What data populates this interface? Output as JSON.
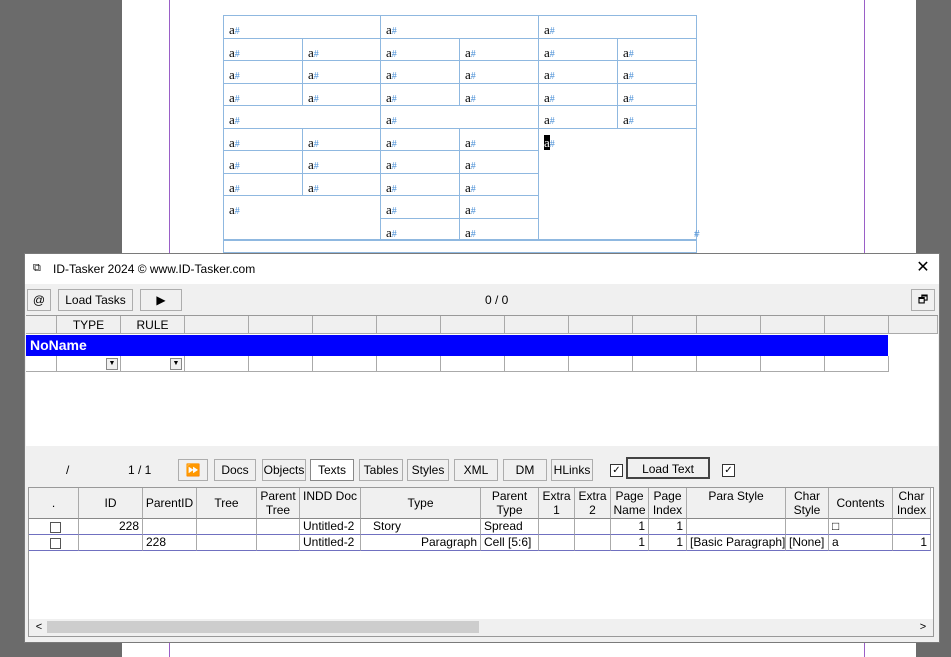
{
  "document": {
    "cell_glyph": "a",
    "hash_glyph": "#"
  },
  "window": {
    "title": "ID-Tasker 2024  © www.ID-Tasker.com",
    "close_label": "✕"
  },
  "toolbar_top": {
    "at_label": "@",
    "load_tasks_label": "Load Tasks",
    "play_label": "▶",
    "counter": "0 / 0",
    "restore_label": "🗗"
  },
  "tasks_grid": {
    "headers": [
      "TYPE",
      "RULE"
    ],
    "selected_task": "NoName",
    "dropdown_arrow": "▼"
  },
  "toolbar_lower": {
    "slash": "/",
    "page_counter": "1 / 1",
    "fast_forward_label": "⏩",
    "tabs": [
      "Docs",
      "Objects",
      "Texts",
      "Tables",
      "Styles",
      "XML",
      "DM",
      "HLinks"
    ],
    "active_tab": "Texts",
    "load_text_label": "Load Text",
    "check1": "✓",
    "check2": "✓"
  },
  "objects_grid": {
    "headers": [
      ".",
      "ID",
      "ParentID",
      "Tree",
      "Parent Tree",
      "INDD Doc",
      "Type",
      "Parent Type",
      "Extra 1",
      "Extra 2",
      "Page Name",
      "Page Index",
      "Para Style",
      "Char Style",
      "Contents",
      "Char Index"
    ],
    "rows": [
      {
        "id": "228",
        "parent_id": "",
        "tree": "",
        "parent_tree": "",
        "indd_doc": "Untitled-2",
        "type": "Story",
        "parent_type": "Spread",
        "extra1": "",
        "extra2": "",
        "page_name": "1",
        "page_index": "1",
        "para_style": "",
        "char_style": "",
        "contents": "□",
        "char_index": ""
      },
      {
        "id": "",
        "parent_id": "228",
        "tree": "",
        "parent_tree": "",
        "indd_doc": "Untitled-2",
        "type": "Paragraph",
        "parent_type": "Cell [5:6]",
        "extra1": "",
        "extra2": "",
        "page_name": "1",
        "page_index": "1",
        "para_style": "[Basic Paragraph]",
        "char_style": "[None]",
        "contents": "a",
        "char_index": "1"
      }
    ],
    "sort_indicator": "⁄",
    "scroll_left": "<",
    "scroll_right": ">"
  }
}
